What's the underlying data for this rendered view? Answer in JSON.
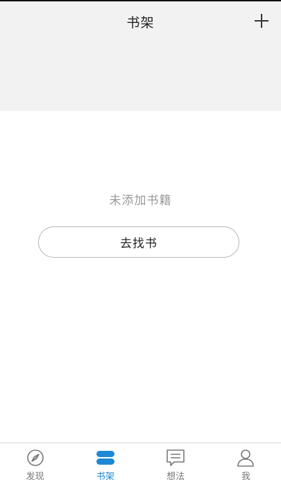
{
  "header": {
    "title": "书架",
    "add_icon": "plus-icon"
  },
  "empty_state": {
    "message": "未添加书籍",
    "button_label": "去找书"
  },
  "tabbar": {
    "active_color": "#1e88d6",
    "inactive_color": "#777777",
    "items": [
      {
        "label": "发现",
        "icon": "compass-icon",
        "active": false
      },
      {
        "label": "书架",
        "icon": "bookshelf-icon",
        "active": true
      },
      {
        "label": "想法",
        "icon": "chat-bubble-icon",
        "active": false
      },
      {
        "label": "我",
        "icon": "person-icon",
        "active": false
      }
    ]
  }
}
